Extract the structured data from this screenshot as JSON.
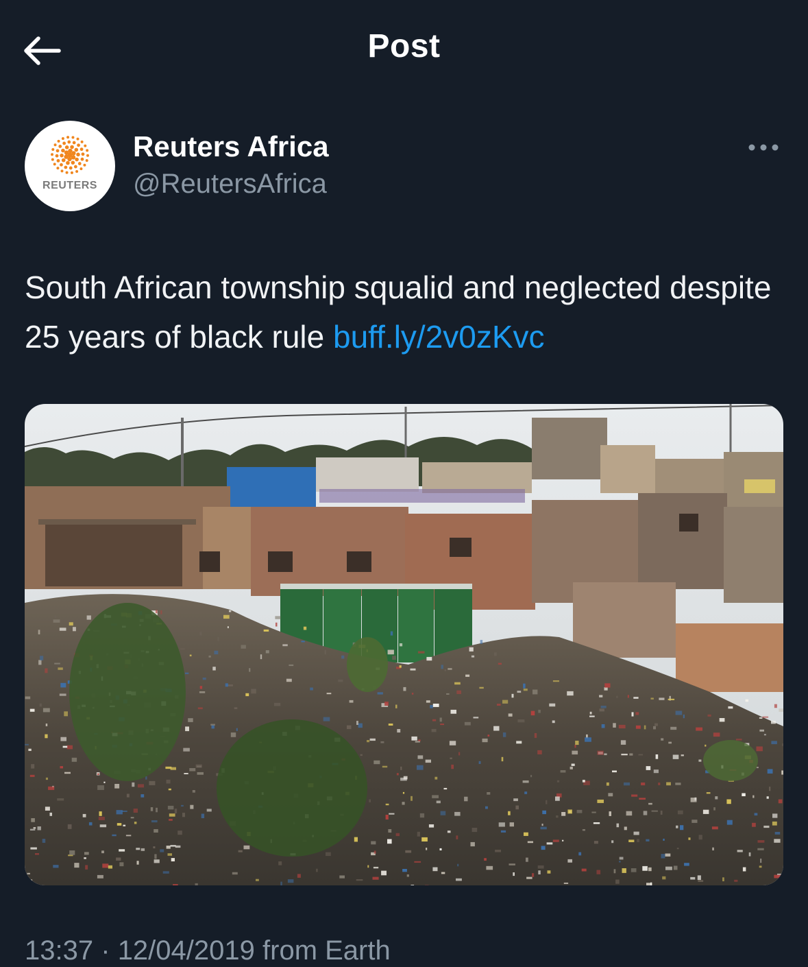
{
  "header": {
    "title": "Post",
    "back_icon": "arrow-left-icon"
  },
  "author": {
    "display_name": "Reuters Africa",
    "handle": "@ReutersAfrica",
    "avatar_text": "REUTERS",
    "more_icon": "more-horizontal-icon"
  },
  "tweet": {
    "text": "South African township squalid and neglected despite 25 years of black rule",
    "link": "buff.ly/2v0zKvc"
  },
  "meta": {
    "time": "13:37",
    "separator": "·",
    "date": "12/04/2019",
    "source": "from Earth"
  },
  "colors": {
    "background": "#151d28",
    "text": "#f1f3f5",
    "secondary": "#8b98a5",
    "link": "#1d9bf0",
    "reuters_orange": "#f0861e"
  }
}
